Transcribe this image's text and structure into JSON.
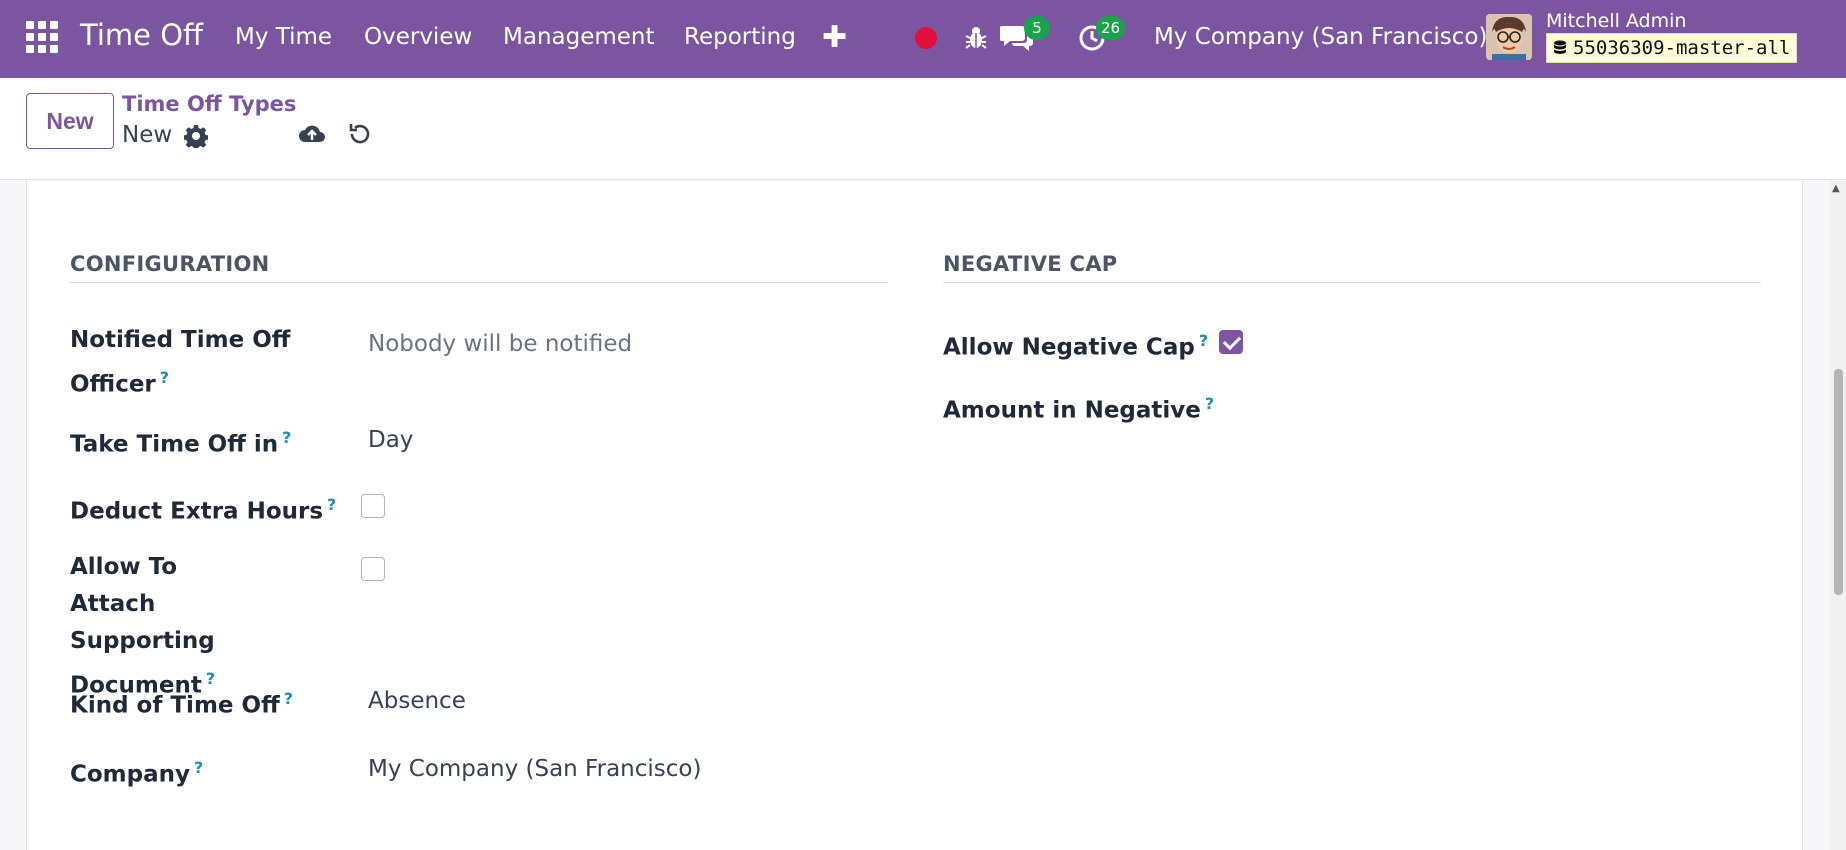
{
  "app": {
    "title": "Time Off"
  },
  "nav": {
    "items": [
      {
        "label": "My Time"
      },
      {
        "label": "Overview"
      },
      {
        "label": "Management"
      },
      {
        "label": "Reporting"
      }
    ]
  },
  "systray": {
    "messages_count": "5",
    "activities_count": "26",
    "company": "My Company (San Francisco)",
    "user_name": "Mitchell Admin",
    "database": "55036309-master-all"
  },
  "control": {
    "new_label": "New",
    "breadcrumb_parent": "Time Off Types",
    "breadcrumb_current": "New"
  },
  "form": {
    "configuration": {
      "title": "CONFIGURATION",
      "fields": {
        "notified_officer_label": "Notified Time Off Officer",
        "notified_officer_placeholder": "Nobody will be notified",
        "take_time_off_in_label": "Take Time Off in",
        "take_time_off_in_value": "Day",
        "deduct_extra_hours_label": "Deduct Extra Hours",
        "attach_document_label": "Allow To Attach Supporting Document",
        "kind_of_time_off_label": "Kind of Time Off",
        "kind_of_time_off_value": "Absence",
        "company_label": "Company",
        "company_value": "My Company (San Francisco)"
      },
      "checks": {
        "deduct_extra_hours": false,
        "attach_document": false
      }
    },
    "negative_cap": {
      "title": "NEGATIVE CAP",
      "allow_negative_cap_label": "Allow Negative Cap",
      "allow_negative_cap": true,
      "amount_in_negative_label": "Amount in Negative"
    }
  },
  "colors": {
    "brand": "#7c55a1",
    "badge": "#1aa34a",
    "record": "#e0103a",
    "help": "#1b8fb0"
  },
  "icons": [
    "apps-grid-icon",
    "plus-icon",
    "record-icon",
    "bug-icon",
    "chat-icon",
    "clock-icon",
    "database-icon",
    "gear-icon",
    "cloud-upload-icon",
    "undo-icon",
    "help-icon"
  ]
}
